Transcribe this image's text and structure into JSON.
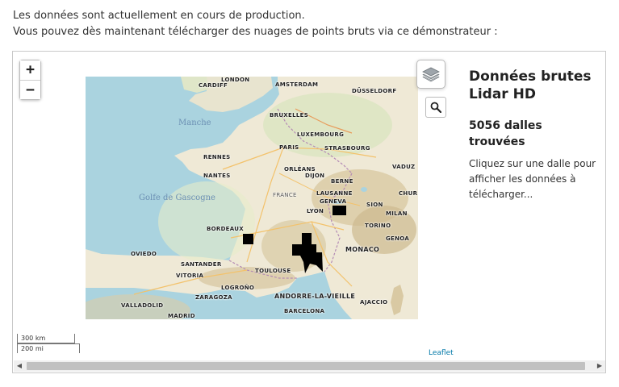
{
  "intro": {
    "line1": "Les données sont actuellement en cours de production.",
    "line2": "Vous pouvez dès maintenant télécharger des nuages de points bruts via ce démonstrateur :"
  },
  "map": {
    "zoom_in": "+",
    "zoom_out": "−",
    "scale_km": "300 km",
    "scale_mi": "200 mi",
    "attribution": "Leaflet",
    "sea_labels": {
      "manche": "Manche",
      "gascogne": "Golfe de Gascogne"
    },
    "cities": {
      "london": "LONDON",
      "cardiff": "CARDIFF",
      "amsterdam": "AMSTERDAM",
      "bruxelles": "BRUXELLES",
      "dusseldorf": "DÜSSELDORF",
      "luxembourg": "LUXEMBOURG",
      "paris": "PARIS",
      "strasbourg": "STRASBOURG",
      "rennes": "RENNES",
      "nantes": "NANTES",
      "orleans": "ORLÉANS",
      "dijon": "DIJON",
      "vaduz": "VADUZ",
      "france": "FRANCE",
      "berne": "BERNE",
      "lausanne": "LAUSANNE",
      "geneva": "GENEVA",
      "chur": "CHUR",
      "sion": "SION",
      "lyon": "LYON",
      "bordeaux": "BORDEAUX",
      "milan": "MILAN",
      "torino": "TORINO",
      "genoa": "GENOA",
      "monaco": "MONACO",
      "oviedo": "OVIEDO",
      "santander": "SANTANDER",
      "toulouse": "TOULOUSE",
      "vitoria": "VITORIA",
      "logrono": "LOGROÑO",
      "zaragoza": "ZARAGOZA",
      "valladolid": "VALLADOLID",
      "andorre": "ANDORRE-LA-VIEILLE",
      "barcelona": "BARCELONA",
      "ajaccio": "AJACCIO",
      "madrid": "MADRID"
    }
  },
  "panel": {
    "title_line1": "Données brutes",
    "title_line2": "Lidar HD",
    "count": "5056 dalles trouvées",
    "hint": "Cliquez sur une dalle pour afficher les données à télécharger..."
  },
  "icons": {
    "layers": "layers-icon",
    "search": "search-icon"
  }
}
